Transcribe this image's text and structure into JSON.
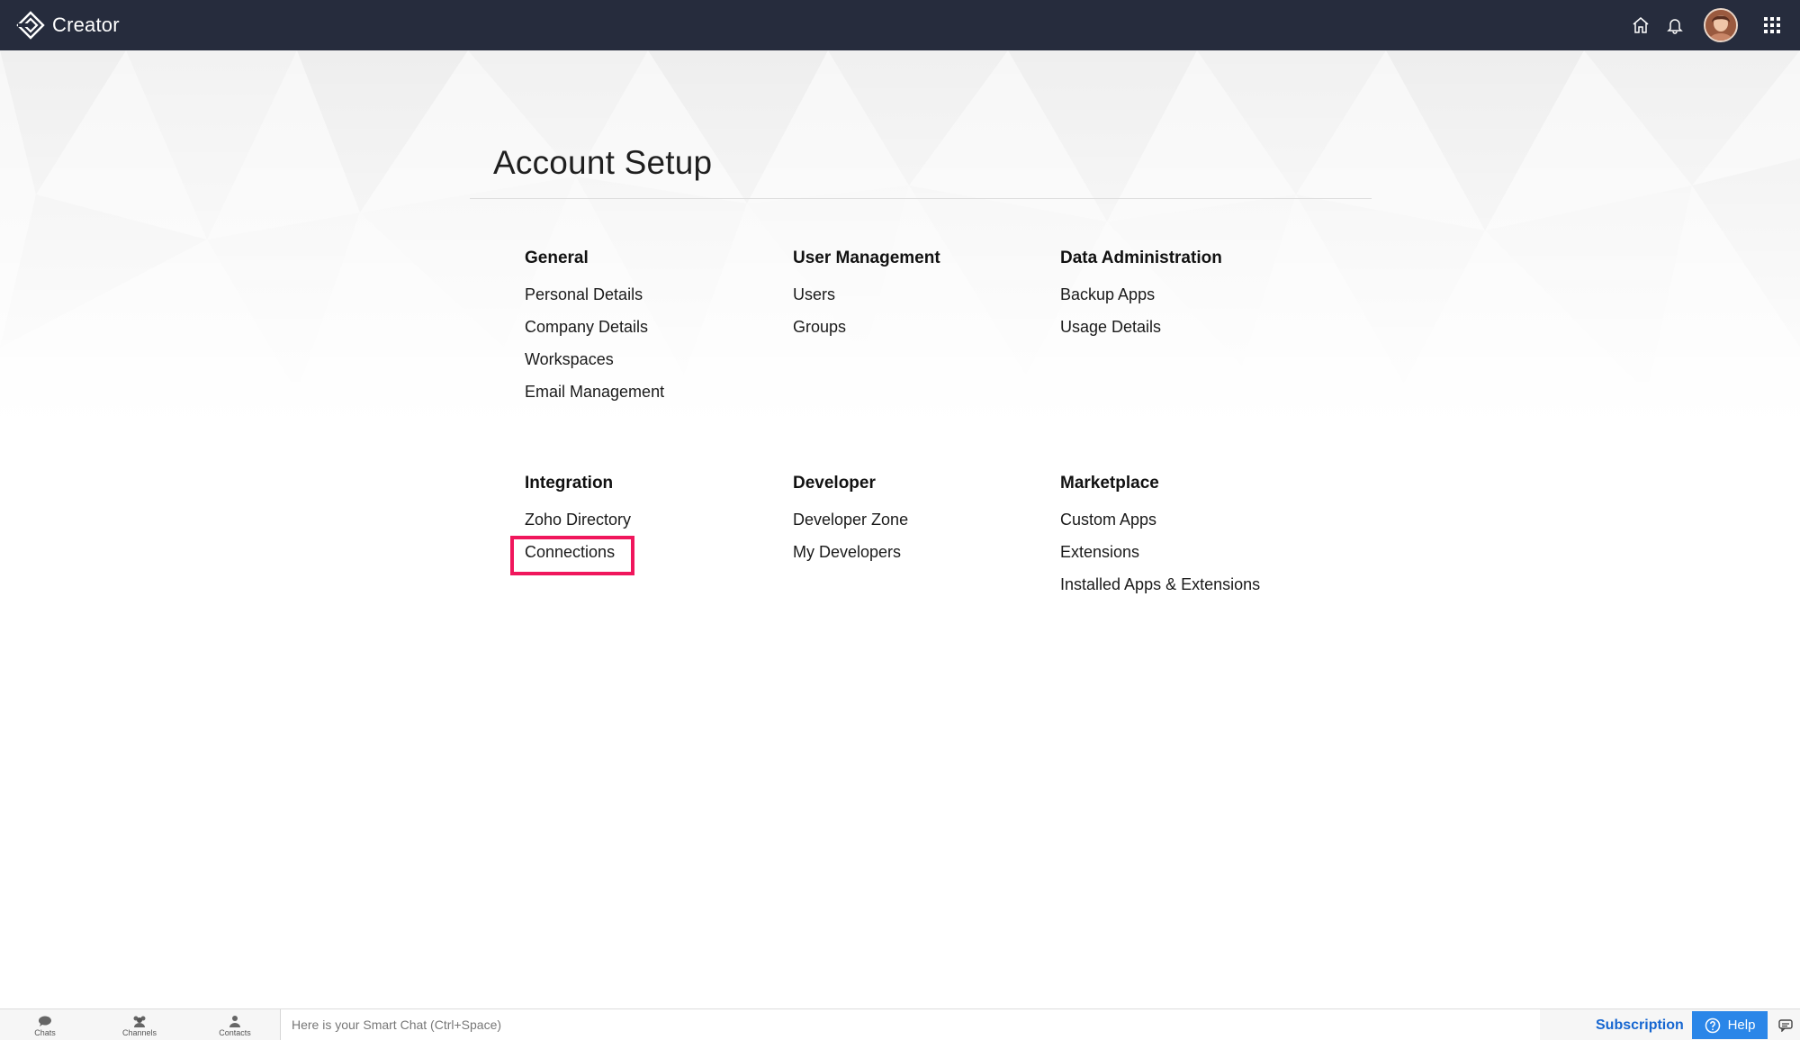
{
  "header": {
    "app_name": "Creator",
    "icons": {
      "logo": "creator-logo-icon",
      "home": "home-icon",
      "notifications": "bell-icon",
      "avatar": "avatar",
      "apps": "apps-grid-icon"
    },
    "background_color": "#262c3d"
  },
  "page": {
    "title": "Account Setup"
  },
  "sections": [
    {
      "heading": "General",
      "items": [
        "Personal Details",
        "Company Details",
        "Workspaces",
        "Email Management"
      ]
    },
    {
      "heading": "User Management",
      "items": [
        "Users",
        "Groups"
      ]
    },
    {
      "heading": "Data Administration",
      "items": [
        "Backup Apps",
        "Usage Details"
      ]
    },
    {
      "heading": "Integration",
      "items": [
        "Zoho Directory",
        "Connections"
      ]
    },
    {
      "heading": "Developer",
      "items": [
        "Developer Zone",
        "My Developers"
      ]
    },
    {
      "heading": "Marketplace",
      "items": [
        "Custom Apps",
        "Extensions",
        "Installed Apps & Extensions"
      ]
    }
  ],
  "highlight": {
    "target": "Connections",
    "color": "#f0165c"
  },
  "bottom_bar": {
    "nav": [
      "Chats",
      "Channels",
      "Contacts"
    ],
    "chat_placeholder": "Here is your Smart Chat (Ctrl+Space)",
    "subscription_label": "Subscription",
    "help_label": "Help",
    "accent_color": "#2a86e8"
  }
}
